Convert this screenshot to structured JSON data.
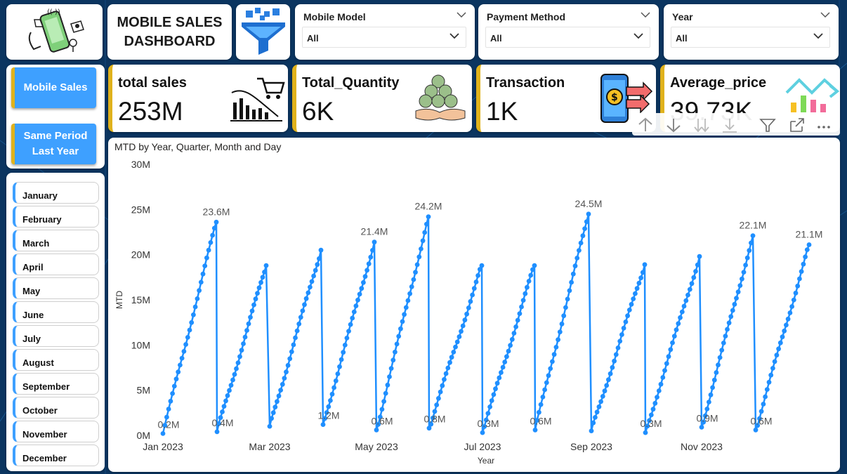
{
  "app": {
    "title": "MOBILE SALES\nDASHBOARD"
  },
  "slicers": [
    {
      "label": "Mobile Model",
      "value": "All"
    },
    {
      "label": "Payment Method",
      "value": "All"
    },
    {
      "label": "Year",
      "value": "All"
    }
  ],
  "nav": {
    "mobile_sales": "Mobile Sales",
    "same_period": "Same Period\nLast Year"
  },
  "months": [
    "January",
    "February",
    "March",
    "April",
    "May",
    "June",
    "July",
    "August",
    "September",
    "October",
    "November",
    "December"
  ],
  "kpis": [
    {
      "title": "total sales",
      "value": "253M",
      "icon": "sales-chart-cart-icon"
    },
    {
      "title": "Total_Quantity",
      "value": "6K",
      "icon": "coins-hand-icon"
    },
    {
      "title": "Transaction",
      "value": "1K",
      "icon": "phone-payment-icon"
    },
    {
      "title": "Average_price",
      "value": "39.73K",
      "icon": "candlestick-trend-icon"
    }
  ],
  "toolbar": [
    "arrow-up-icon",
    "arrow-down-icon",
    "double-arrow-down-icon",
    "expand-down-icon",
    "filter-icon",
    "focus-mode-icon",
    "more-options-icon"
  ],
  "colors": {
    "accent": "#3ea0ff",
    "series": "#1f8fff",
    "kpi_border": "#e0b21c",
    "background": "#0d3a66"
  },
  "chart_data": {
    "type": "line",
    "title": "MTD by Year, Quarter, Month and Day",
    "xlabel": "Year",
    "ylabel": "MTD",
    "ylim": [
      0,
      30
    ],
    "y_unit": "M",
    "yticks": [
      "0M",
      "5M",
      "10M",
      "15M",
      "20M",
      "25M",
      "30M"
    ],
    "xticks": [
      "Jan 2023",
      "Mar 2023",
      "May 2023",
      "Jul 2023",
      "Sep 2023",
      "Nov 2023"
    ],
    "grid": false,
    "series": [
      {
        "months": [
          {
            "month": "Jan 2023",
            "start": 0.2,
            "end": 23.6,
            "start_label": "0.2M",
            "end_label": "23.6M"
          },
          {
            "month": "Feb 2023",
            "start": 0.4,
            "end": 18.8,
            "start_label": "0.4M",
            "end_label": ""
          },
          {
            "month": "Mar 2023",
            "start": 1.0,
            "end": 20.5,
            "start_label": "",
            "end_label": ""
          },
          {
            "month": "Apr 2023",
            "start": 1.2,
            "end": 21.4,
            "start_label": "1.2M",
            "end_label": "21.4M"
          },
          {
            "month": "May 2023",
            "start": 0.6,
            "end": 24.2,
            "start_label": "0.6M",
            "end_label": "24.2M"
          },
          {
            "month": "Jun 2023",
            "start": 0.8,
            "end": 18.8,
            "start_label": "0.8M",
            "end_label": ""
          },
          {
            "month": "Jul 2023",
            "start": 0.3,
            "end": 18.8,
            "start_label": "0.3M",
            "end_label": ""
          },
          {
            "month": "Aug 2023",
            "start": 0.6,
            "end": 24.5,
            "start_label": "0.6M",
            "end_label": "24.5M"
          },
          {
            "month": "Sep 2023",
            "start": 0.5,
            "end": 18.9,
            "start_label": "",
            "end_label": ""
          },
          {
            "month": "Oct 2023",
            "start": 0.3,
            "end": 19.8,
            "start_label": "0.3M",
            "end_label": ""
          },
          {
            "month": "Nov 2023",
            "start": 0.9,
            "end": 22.1,
            "start_label": "0.9M",
            "end_label": "22.1M"
          },
          {
            "month": "Dec 2023",
            "start": 0.6,
            "end": 19.8,
            "start_label": "0.6M",
            "end_label": ""
          },
          {
            "month": "Dec 2023 (cont.)",
            "start": 0.6,
            "end": 21.1,
            "start_label": "",
            "end_label": "21.1M"
          }
        ]
      }
    ]
  }
}
